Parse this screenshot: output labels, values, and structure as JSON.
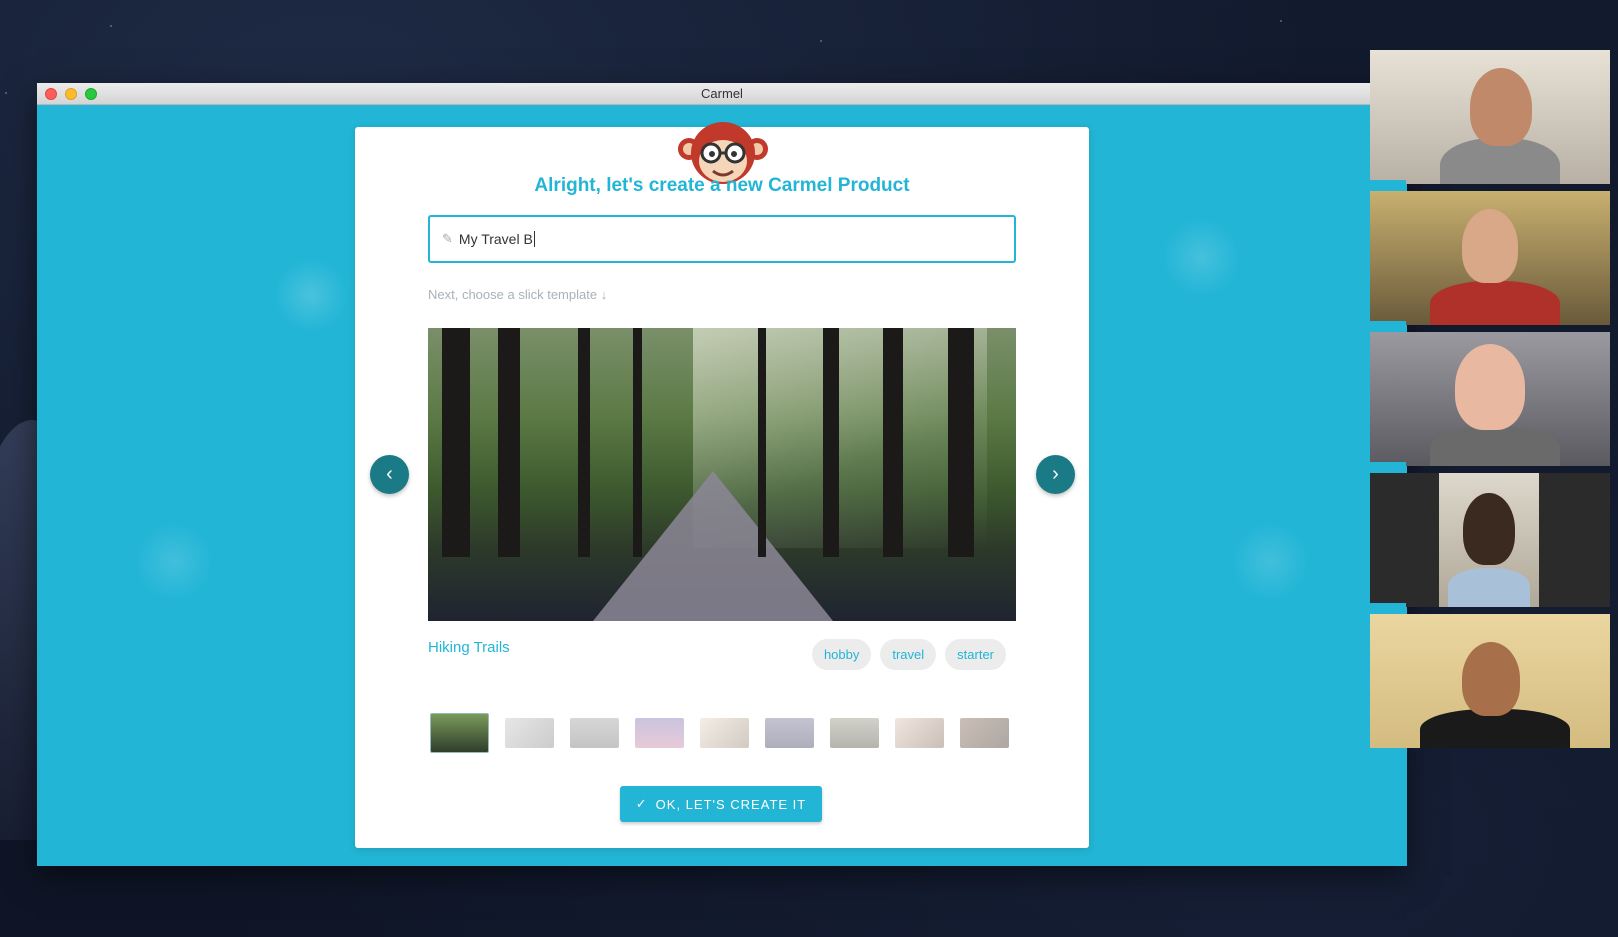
{
  "window": {
    "title": "Carmel"
  },
  "card": {
    "heading": "Alright, let's create a new Carmel Product",
    "name_input_value": "My Travel B",
    "hint": "Next, choose a slick template ↓",
    "template": {
      "title": "Hiking Trails",
      "tags": [
        "hobby",
        "travel",
        "starter"
      ]
    },
    "thumbnails_count": 9,
    "selected_thumbnail": 1,
    "create_button_label": "OK, LET'S CREATE IT"
  },
  "colors": {
    "accent": "#22b5d6",
    "nav_button": "#1a7a85",
    "tag_bg": "#ececec"
  },
  "icons": {
    "prev": "chevron-left-icon",
    "next": "chevron-right-icon",
    "input": "pencil-icon",
    "create": "checkmark-icon"
  }
}
